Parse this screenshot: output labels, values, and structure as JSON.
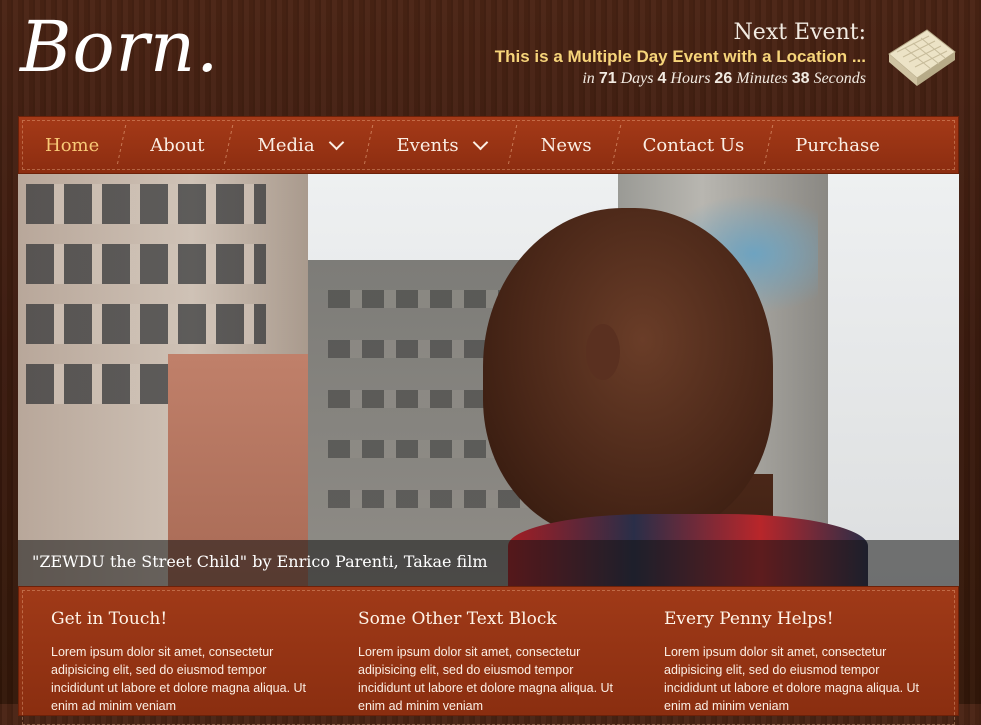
{
  "header": {
    "logo": "Born.",
    "next_event_title": "Next Event:",
    "event_name": "This is a Multiple Day Event with a Location ...",
    "countdown": {
      "prefix": "in",
      "days": "71",
      "days_label": "Days",
      "hours": "4",
      "hours_label": "Hours",
      "minutes": "26",
      "minutes_label": "Minutes",
      "seconds": "38",
      "seconds_label": "Seconds"
    }
  },
  "nav": {
    "items": [
      {
        "label": "Home"
      },
      {
        "label": "About"
      },
      {
        "label": "Media"
      },
      {
        "label": "Events"
      },
      {
        "label": "News"
      },
      {
        "label": "Contact Us"
      },
      {
        "label": "Purchase"
      }
    ]
  },
  "hero": {
    "caption": "\"ZEWDU the Street Child\" by Enrico Parenti, Takae film"
  },
  "blocks": [
    {
      "title": "Get in Touch!",
      "text": "Lorem ipsum dolor sit amet, consectetur adipisicing elit, sed do eiusmod tempor incididunt ut labore et dolore magna aliqua. Ut enim ad minim veniam"
    },
    {
      "title": "Some Other Text Block",
      "text": "Lorem ipsum dolor sit amet, consectetur adipisicing elit, sed do eiusmod tempor incididunt ut labore et dolore magna aliqua. Ut enim ad minim veniam"
    },
    {
      "title": "Every Penny Helps!",
      "text": "Lorem ipsum dolor sit amet, consectetur adipisicing elit, sed do eiusmod tempor incididunt ut labore et dolore magna aliqua. Ut enim ad minim veniam"
    }
  ],
  "colors": {
    "accent_gold": "#f6d47a",
    "nav_active": "#f8c977",
    "nav_bg": "#9a3514",
    "wood_bg": "#3a1c10"
  },
  "icons": {
    "calendar": "calendar-icon",
    "dropdown": "chevron-down-icon"
  }
}
